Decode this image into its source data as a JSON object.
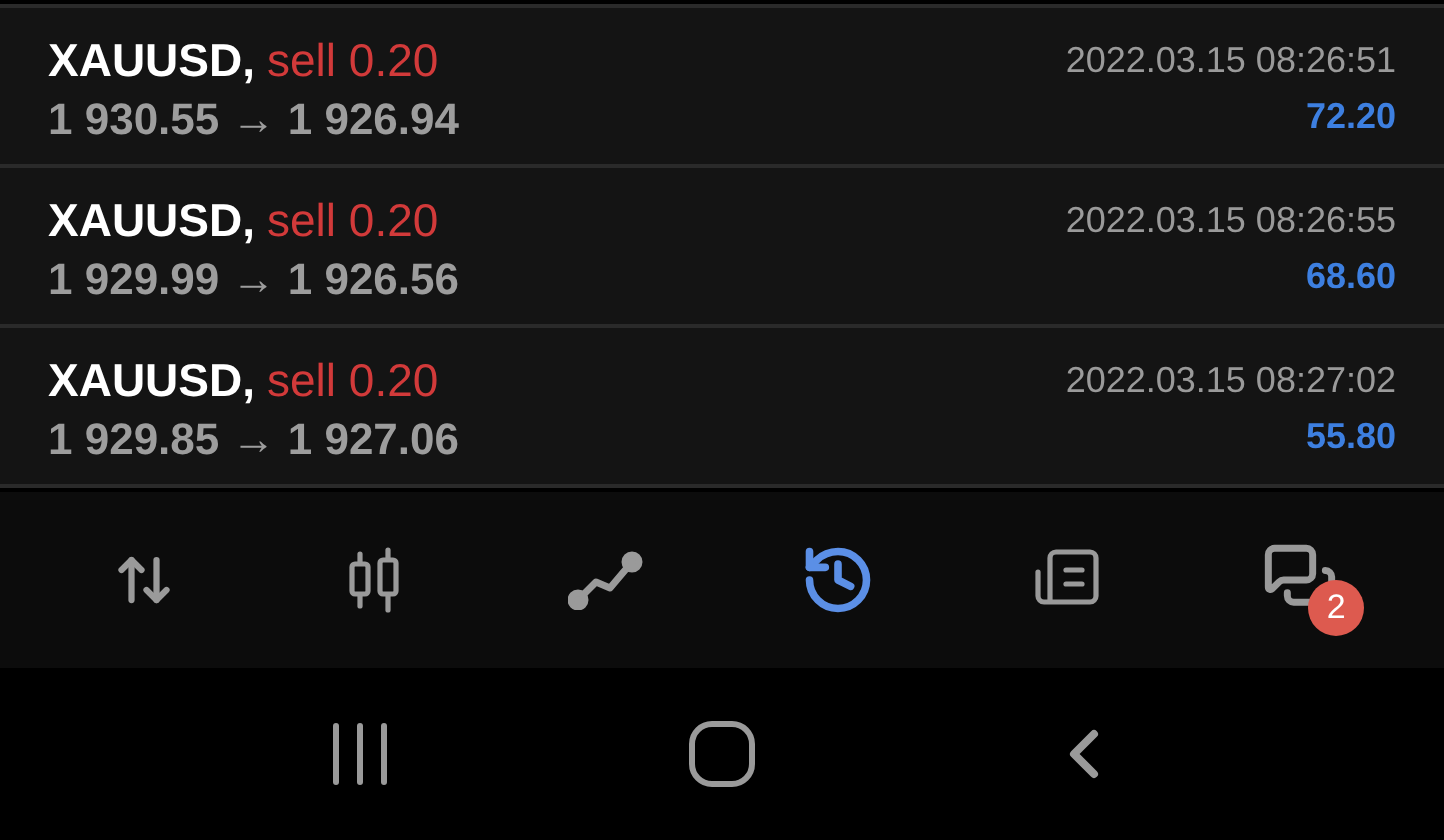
{
  "trades": [
    {
      "symbol": "XAUUSD,",
      "side": "sell 0.20",
      "prices": "1 930.55 → 1 926.94",
      "time": "2022.03.15 08:26:51",
      "profit": "72.20"
    },
    {
      "symbol": "XAUUSD,",
      "side": "sell 0.20",
      "prices": "1 929.99 → 1 926.56",
      "time": "2022.03.15 08:26:55",
      "profit": "68.60"
    },
    {
      "symbol": "XAUUSD,",
      "side": "sell 0.20",
      "prices": "1 929.85 → 1 927.06",
      "time": "2022.03.15 08:27:02",
      "profit": "55.80"
    }
  ],
  "tabs": [
    {
      "kind": "quotes",
      "selected": false
    },
    {
      "kind": "chart",
      "selected": false
    },
    {
      "kind": "trade",
      "selected": false
    },
    {
      "kind": "history",
      "selected": true
    },
    {
      "kind": "news",
      "selected": false
    },
    {
      "kind": "messages",
      "selected": false,
      "badge": "2"
    }
  ],
  "system_nav": [
    {
      "kind": "recents"
    },
    {
      "kind": "home"
    },
    {
      "kind": "back"
    }
  ]
}
